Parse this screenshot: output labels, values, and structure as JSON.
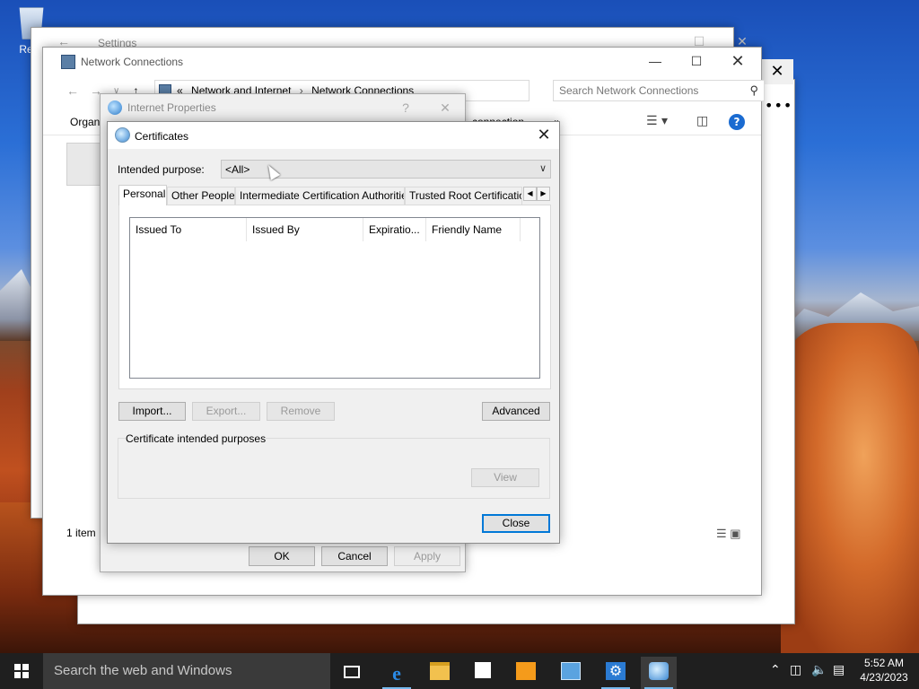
{
  "desktop": {
    "recycle_bin_label": "Recy"
  },
  "settings_window": {
    "title": "Settings"
  },
  "network_connections": {
    "title": "Network Connections",
    "breadcrumb": {
      "prefix": "«",
      "items": [
        "Network and Internet",
        "Network Connections"
      ]
    },
    "search_placeholder": "Search Network Connections",
    "organize_label": "Organ",
    "connection_label": "connection",
    "more_label": "»",
    "status_items": "1 item"
  },
  "internet_properties": {
    "title": "Internet Properties",
    "help_label": "?",
    "buttons": {
      "ok": "OK",
      "cancel": "Cancel",
      "apply": "Apply"
    }
  },
  "certificates": {
    "title": "Certificates",
    "intended_purpose_label": "Intended purpose:",
    "intended_purpose_value": "<All>",
    "tabs": [
      "Personal",
      "Other People",
      "Intermediate Certification Authorities",
      "Trusted Root Certification"
    ],
    "columns": [
      "Issued To",
      "Issued By",
      "Expiratio...",
      "Friendly Name"
    ],
    "buttons": {
      "import": "Import...",
      "export": "Export...",
      "remove": "Remove",
      "advanced": "Advanced",
      "view": "View",
      "close": "Close"
    },
    "purposes_group_label": "Certificate intended purposes"
  },
  "taskbar": {
    "search_text": "Search the web and Windows",
    "time": "5:52 AM",
    "date": "4/23/2023"
  },
  "colors": {
    "accent": "#0078d7",
    "taskbar": "#1f1f1f",
    "dialog_bg": "#f0f0f0"
  },
  "icons": {
    "start": "windows-logo-icon",
    "task_view": "task-view-icon",
    "edge": "edge-icon",
    "explorer": "file-explorer-icon",
    "store": "store-icon",
    "media": "media-player-icon",
    "control_panel": "control-panel-icon",
    "settings": "settings-gear-icon",
    "certificates": "certificates-icon"
  }
}
